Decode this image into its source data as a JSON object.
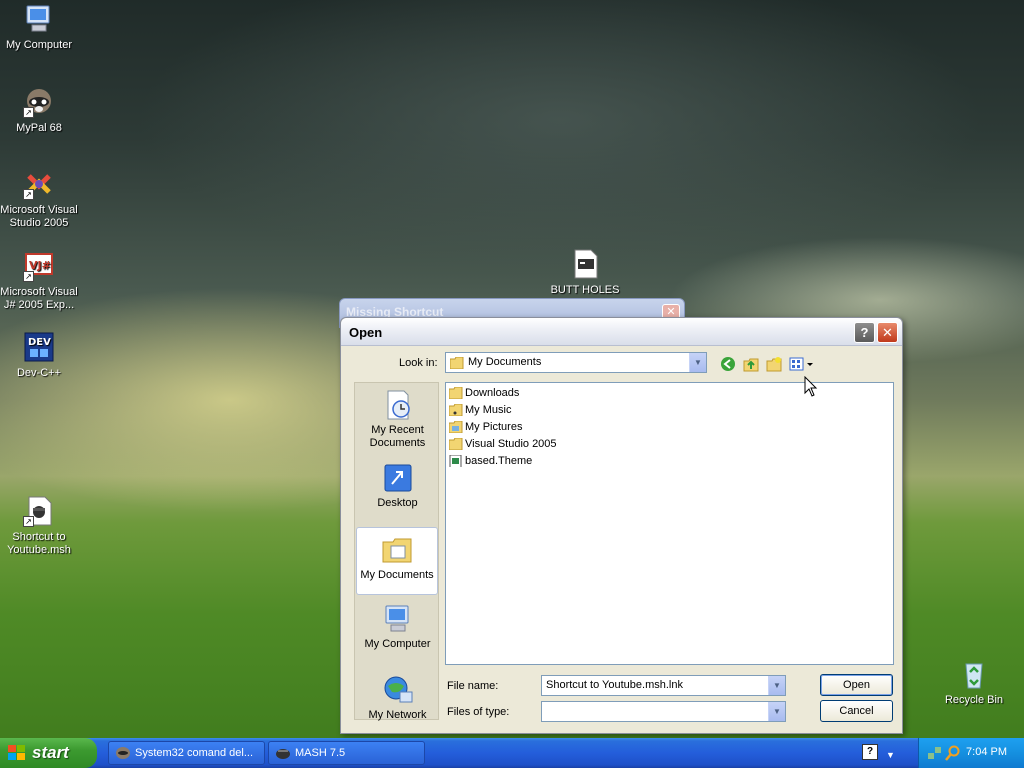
{
  "desktop": {
    "icons": {
      "my_computer": "My Computer",
      "mypal": "MyPal 68",
      "vs2005_line1": "Microsoft Visual",
      "vs2005_line2": "Studio 2005",
      "vj_line1": "Microsoft Visual",
      "vj_line2": "J# 2005 Exp...",
      "devcpp": "Dev-C++",
      "youtube_line1": "Shortcut to",
      "youtube_line2": "Youtube.msh",
      "butt_holes": "BUTT HOLES",
      "recycle_bin": "Recycle Bin"
    }
  },
  "background_window": {
    "title": "Missing Shortcut",
    "close_glyph": "✕"
  },
  "dialog": {
    "title": "Open",
    "help_glyph": "?",
    "close_glyph": "✕",
    "look_in_label": "Look in:",
    "look_in_value": "My Documents",
    "places": {
      "recent_line1": "My Recent",
      "recent_line2": "Documents",
      "desktop": "Desktop",
      "my_documents": "My Documents",
      "my_computer": "My Computer",
      "my_network": "My Network"
    },
    "files": [
      {
        "name": "Downloads",
        "type": "folder"
      },
      {
        "name": "My Music",
        "type": "folder"
      },
      {
        "name": "My Pictures",
        "type": "folder"
      },
      {
        "name": "Visual Studio 2005",
        "type": "folder"
      },
      {
        "name": "based.Theme",
        "type": "file"
      }
    ],
    "file_name_label": "File name:",
    "file_name_value": "Shortcut to Youtube.msh.lnk",
    "files_of_type_label": "Files of type:",
    "files_of_type_value": "",
    "open_button": "Open",
    "cancel_button": "Cancel"
  },
  "taskbar": {
    "start_label": "start",
    "tasks": [
      {
        "label": "System32 comand del..."
      },
      {
        "label": "MASH 7.5"
      }
    ],
    "help_glyph": "?",
    "clock": "7:04 PM"
  },
  "colors": {
    "xp_blue": "#245edb",
    "start_green": "#3c9a30",
    "dialog_face": "#ece9d8",
    "folder_yellow": "#f2d572"
  }
}
